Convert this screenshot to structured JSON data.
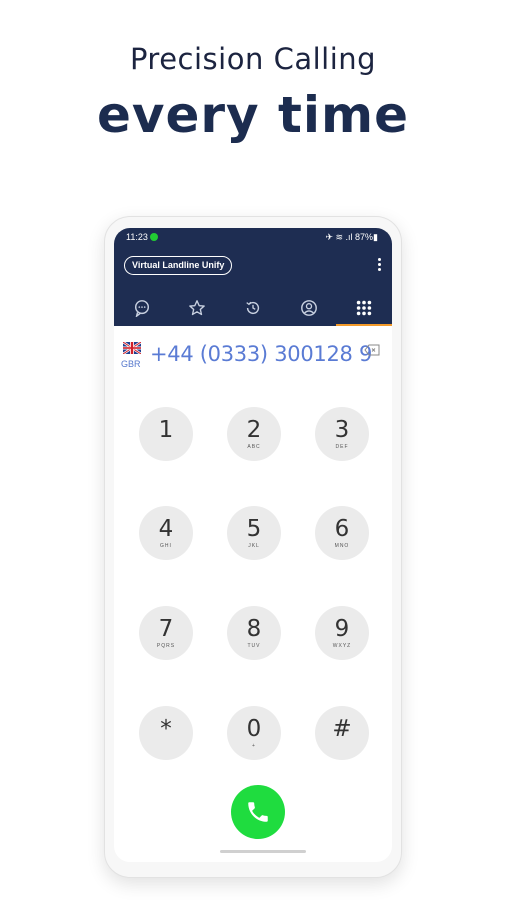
{
  "promo": {
    "line1": "Precision Calling",
    "line2": "every time"
  },
  "status_bar": {
    "time": "11:23",
    "icons": "✈ ≋ .ıl 87%▮"
  },
  "app_bar": {
    "app_name": "Virtual Landline Unify"
  },
  "tabs": [
    {
      "name": "messages",
      "icon": "chat-bubble-icon"
    },
    {
      "name": "favorites",
      "icon": "star-icon"
    },
    {
      "name": "recents",
      "icon": "history-icon"
    },
    {
      "name": "contacts",
      "icon": "contact-icon"
    },
    {
      "name": "keypad",
      "icon": "keypad-grid-icon",
      "active": true
    }
  ],
  "dialer": {
    "country_code": "GBR",
    "number": "+44 (0333) 300128 9",
    "keys": [
      {
        "digit": "1",
        "letters": ""
      },
      {
        "digit": "2",
        "letters": "ABC"
      },
      {
        "digit": "3",
        "letters": "DEF"
      },
      {
        "digit": "4",
        "letters": "GHI"
      },
      {
        "digit": "5",
        "letters": "JKL"
      },
      {
        "digit": "6",
        "letters": "MNO"
      },
      {
        "digit": "7",
        "letters": "PQRS"
      },
      {
        "digit": "8",
        "letters": "TUV"
      },
      {
        "digit": "9",
        "letters": "WXYZ"
      },
      {
        "digit": "*",
        "letters": ""
      },
      {
        "digit": "0",
        "letters": "+"
      },
      {
        "digit": "#",
        "letters": ""
      }
    ]
  },
  "colors": {
    "appbar": "#1e2d52",
    "active_tab_indicator": "#f39a2a",
    "call_button": "#1fdc3f",
    "number_text": "#5a7bd4"
  }
}
